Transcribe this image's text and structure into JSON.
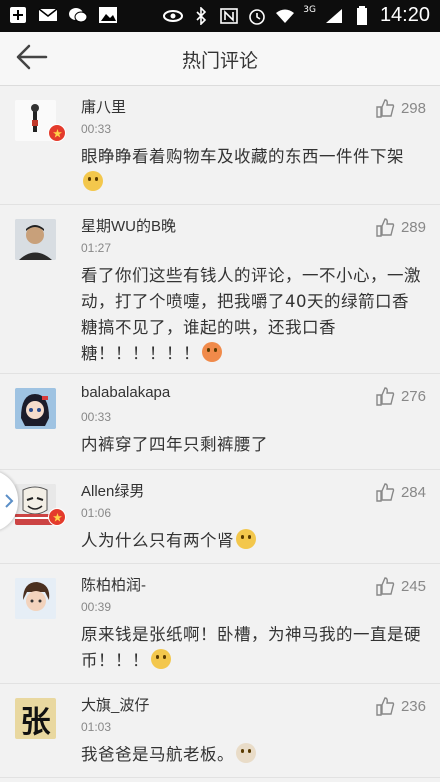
{
  "status_bar": {
    "time": "14:20",
    "network": "3G"
  },
  "header": {
    "title": "热门评论"
  },
  "comments": [
    {
      "name": "庸八里",
      "time": "00:33",
      "likes": "298",
      "text": "眼睁睁看着购物车及收藏的东西一件件下架",
      "emoji": "emoji-face",
      "badge": true
    },
    {
      "name": "星期WU的B晚",
      "time": "01:27",
      "likes": "289",
      "text": "看了你们这些有钱人的评论，一不小心，一激动，打了个喷嚏，把我嚼了40天的绿箭口香糖搞不见了，谁起的哄，还我口香糖！！！！！！",
      "emoji": "emoji-face",
      "badge": false
    },
    {
      "name": "balabalakapa",
      "time": "00:33",
      "likes": "276",
      "text": "内裤穿了四年只剩裤腰了",
      "emoji": "",
      "badge": false
    },
    {
      "name": "Allen绿男",
      "time": "01:06",
      "likes": "284",
      "text": "人为什么只有两个肾",
      "emoji": "emoji-face",
      "badge": true
    },
    {
      "name": "陈柏柏润-",
      "time": "00:39",
      "likes": "245",
      "text": "原来钱是张纸啊！卧槽，为神马我的一直是硬币！！！",
      "emoji": "emoji-face",
      "badge": false
    },
    {
      "name": "大旗_波仔",
      "time": "01:03",
      "likes": "236",
      "text": "我爸爸是马航老板。",
      "emoji": "emoji-face",
      "badge": false,
      "avatar_char": "张"
    }
  ]
}
